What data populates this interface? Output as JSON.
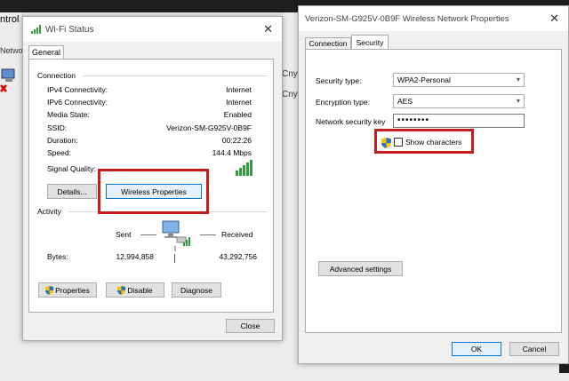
{
  "background": {
    "title": "ntrol I",
    "nav_label": "Networ",
    "cny1": "Cny",
    "cny2": "Cny"
  },
  "wifi_status": {
    "title": "Wi-Fi Status",
    "tab": "General",
    "connection_heading": "Connection",
    "rows": [
      {
        "label": "IPv4 Connectivity:",
        "value": "Internet"
      },
      {
        "label": "IPv6 Connectivity:",
        "value": "Internet"
      },
      {
        "label": "Media State:",
        "value": "Enabled"
      },
      {
        "label": "SSID:",
        "value": "Verizon-SM-G925V-0B9F"
      },
      {
        "label": "Duration:",
        "value": "00:22:26"
      },
      {
        "label": "Speed:",
        "value": "144.4 Mbps"
      }
    ],
    "signal_label": "Signal Quality:",
    "details_button": "Details...",
    "wireless_properties_button": "Wireless Properties",
    "activity_heading": "Activity",
    "sent_label": "Sent",
    "received_label": "Received",
    "bytes_label": "Bytes:",
    "bytes_sent": "12,994,858",
    "bytes_received": "43,292,756",
    "properties_button": "Properties",
    "disable_button": "Disable",
    "diagnose_button": "Diagnose",
    "close_button": "Close"
  },
  "network_properties": {
    "title": "Verizon-SM-G925V-0B9F Wireless Network Properties",
    "tabs": [
      "Connection",
      "Security"
    ],
    "security_type_label": "Security type:",
    "security_type_value": "WPA2-Personal",
    "encryption_type_label": "Encryption type:",
    "encryption_type_value": "AES",
    "key_label": "Network security key",
    "key_value": "••••••••",
    "show_characters_label": "Show characters",
    "advanced_button": "Advanced settings",
    "ok_button": "OK",
    "cancel_button": "Cancel"
  },
  "colors": {
    "highlight": "#c41e1e",
    "signal_green": "#2e9e3a",
    "focus_blue": "#0078d7"
  }
}
